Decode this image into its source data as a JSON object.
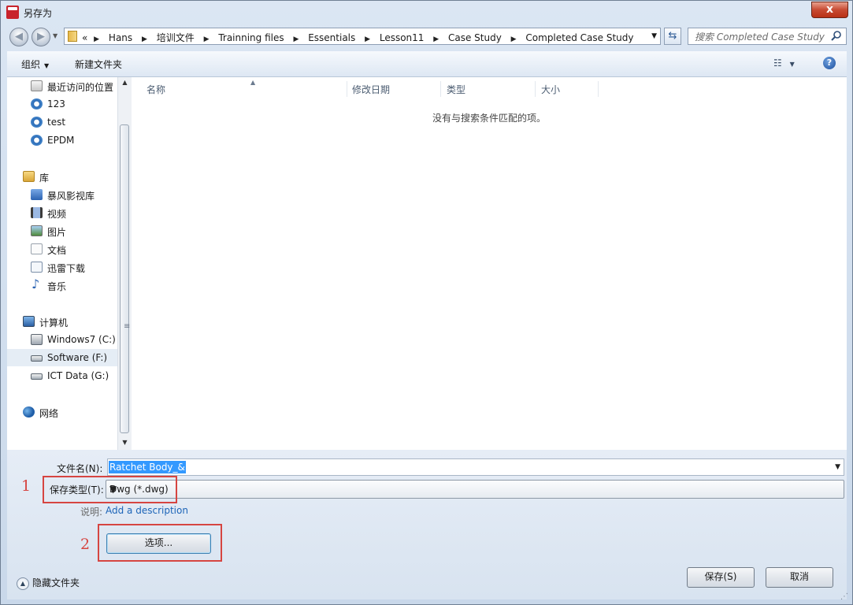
{
  "window": {
    "title": "另存为",
    "app_icon": "autocad-2017-icon",
    "close_label": "x"
  },
  "address": {
    "back_icon": "arrow-left",
    "forward_icon": "arrow-right",
    "prefix": "«",
    "crumbs": [
      "Hans",
      "培训文件",
      "Trainning files",
      "Essentials",
      "Lesson11",
      "Case Study",
      "Completed Case Study"
    ],
    "search_placeholder": "搜索 Completed Case Study"
  },
  "toolbar": {
    "organize": "组织",
    "new_folder": "新建文件夹"
  },
  "nav": {
    "items": [
      {
        "label": "最近访问的位置",
        "icon": "recent-places-icon"
      },
      {
        "label": "123",
        "icon": "ie-icon"
      },
      {
        "label": "test",
        "icon": "ie-icon"
      },
      {
        "label": "EPDM",
        "icon": "ie-icon"
      },
      {
        "label": "库",
        "icon": "library-icon"
      },
      {
        "label": "暴风影视库",
        "icon": "media-library-icon"
      },
      {
        "label": "视频",
        "icon": "video-icon"
      },
      {
        "label": "图片",
        "icon": "pictures-icon"
      },
      {
        "label": "文档",
        "icon": "documents-icon"
      },
      {
        "label": "迅雷下载",
        "icon": "thunder-download-icon"
      },
      {
        "label": "音乐",
        "icon": "music-icon"
      },
      {
        "label": "计算机",
        "icon": "computer-icon"
      },
      {
        "label": "Windows7 (C:)",
        "icon": "system-drive-icon"
      },
      {
        "label": "Software (F:)",
        "icon": "drive-icon"
      },
      {
        "label": "ICT Data (G:)",
        "icon": "drive-icon"
      },
      {
        "label": "网络",
        "icon": "network-icon"
      }
    ],
    "selected": "Software (F:)"
  },
  "file_list": {
    "columns": [
      "名称",
      "修改日期",
      "类型",
      "大小"
    ],
    "empty_message": "没有与搜索条件匹配的项。"
  },
  "form": {
    "filename_label": "文件名(N):",
    "filename_value": "Ratchet Body_&",
    "filetype_label": "保存类型(T):",
    "filetype_value": "Dwg (*.dwg)",
    "description_label": "说明:",
    "description_link": "Add a description",
    "options_button": "选项...",
    "save_button": "保存(S)",
    "cancel_button": "取消",
    "hide_folders": "隐藏文件夹"
  },
  "annotations": {
    "first": "1",
    "second": "2",
    "color": "#d64541"
  }
}
